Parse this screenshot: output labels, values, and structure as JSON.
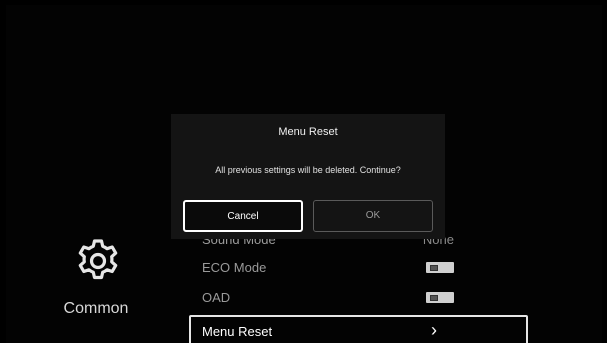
{
  "sidebar": {
    "category_icon": "gear-icon",
    "category_label": "Common"
  },
  "menu": {
    "items": [
      {
        "label": "Sound Mode",
        "value": "None"
      },
      {
        "label": "ECO Mode",
        "control": "toggle-off"
      },
      {
        "label": "OAD",
        "control": "toggle-off"
      },
      {
        "label": "Menu Reset",
        "control": "chevron-right-icon"
      }
    ],
    "chevron": "›"
  },
  "dialog": {
    "title": "Menu Reset",
    "message": "All previous settings will be deleted. Continue?",
    "cancel_label": "Cancel",
    "ok_label": "OK"
  },
  "colors": {
    "background": "#000000",
    "dialog_background": "#141414",
    "focus_border": "#ffffff"
  }
}
